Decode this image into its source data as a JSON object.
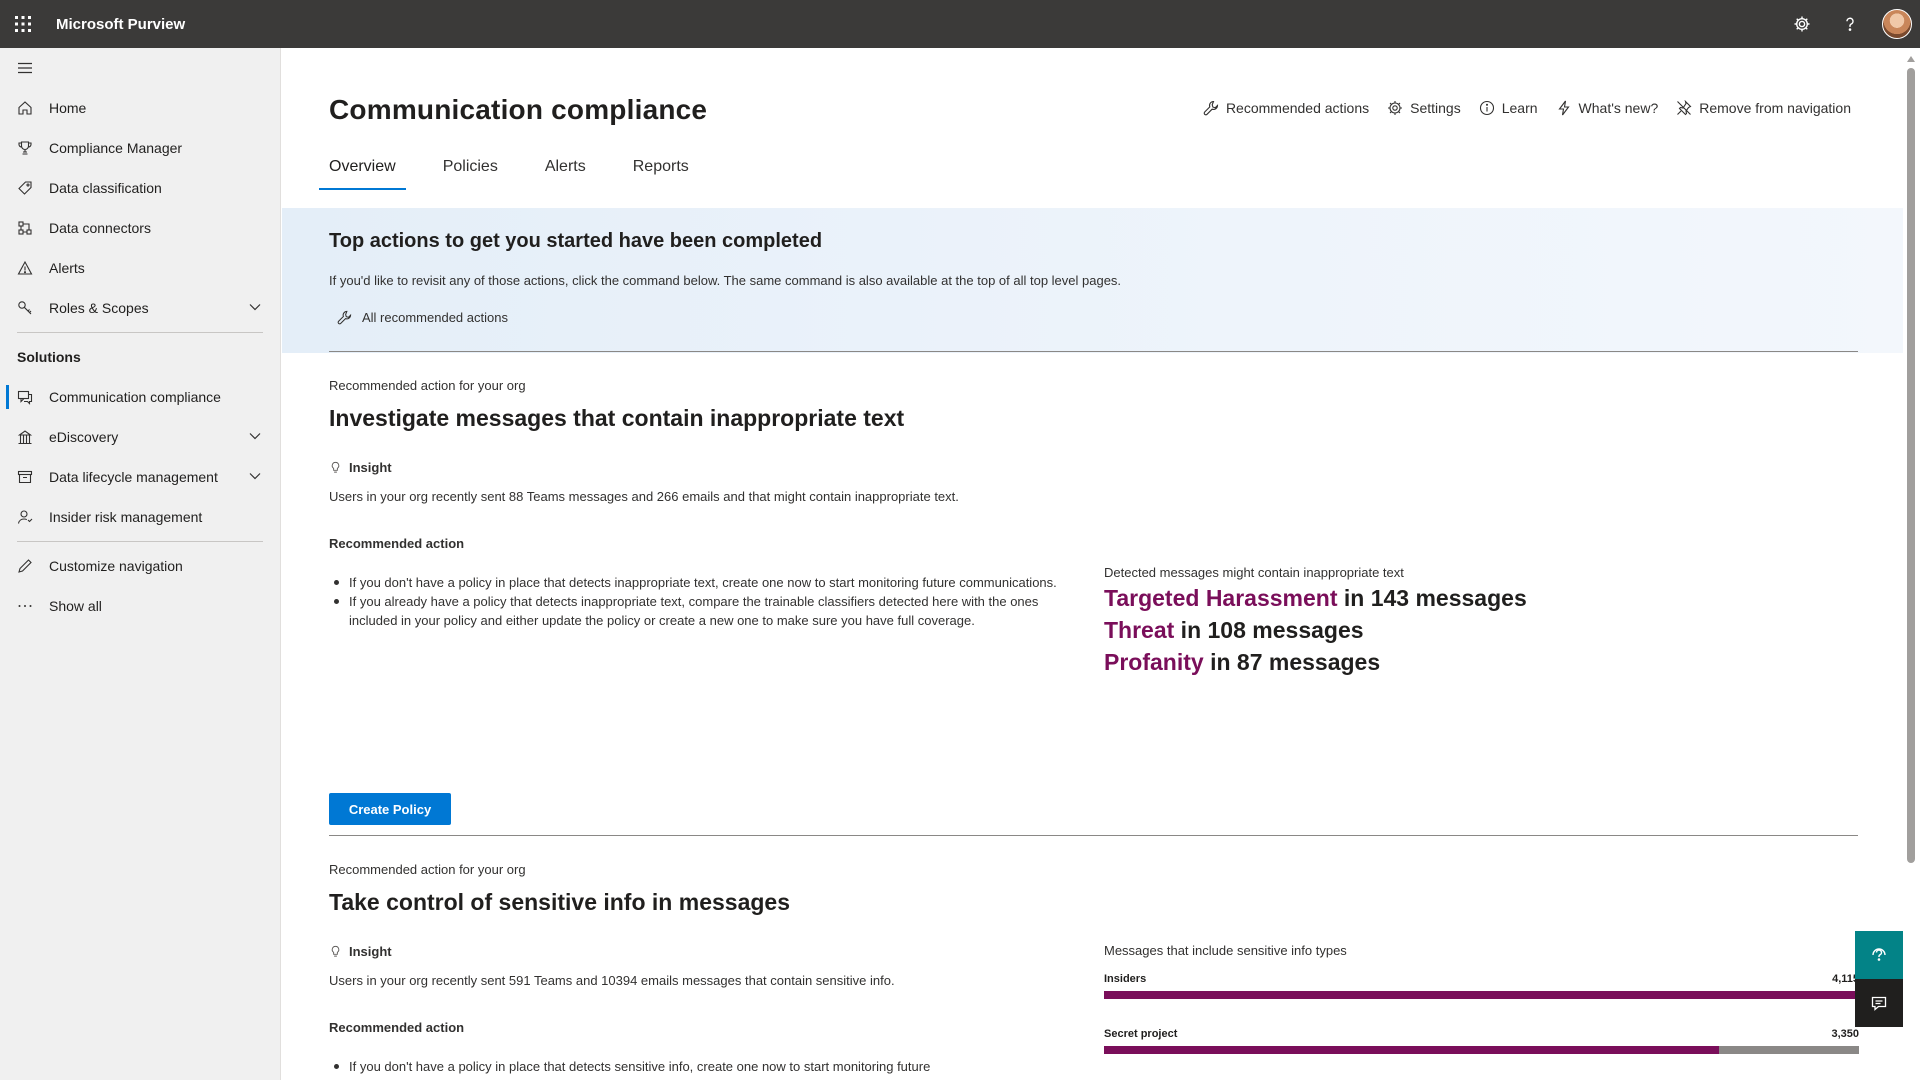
{
  "app": {
    "name": "Microsoft Purview"
  },
  "topbar": {
    "icons": [
      "waffle-icon",
      "settings-icon",
      "help-icon",
      "avatar"
    ]
  },
  "sidebar": {
    "items": [
      {
        "label": "Home",
        "icon": "home-icon"
      },
      {
        "label": "Compliance Manager",
        "icon": "trophy-icon"
      },
      {
        "label": "Data classification",
        "icon": "tag-icon"
      },
      {
        "label": "Data connectors",
        "icon": "connector-icon"
      },
      {
        "label": "Alerts",
        "icon": "warning-icon"
      },
      {
        "label": "Roles & Scopes",
        "icon": "key-icon",
        "expandable": true
      }
    ],
    "section_label": "Solutions",
    "solutions": [
      {
        "label": "Communication compliance",
        "icon": "chat-icon",
        "active": true
      },
      {
        "label": "eDiscovery",
        "icon": "building-icon",
        "expandable": true
      },
      {
        "label": "Data lifecycle management",
        "icon": "archive-icon",
        "expandable": true
      },
      {
        "label": "Insider risk management",
        "icon": "person-icon"
      }
    ],
    "footer": [
      {
        "label": "Customize navigation",
        "icon": "pencil-icon"
      },
      {
        "label": "Show all",
        "icon": "ellipsis-icon"
      }
    ]
  },
  "page": {
    "title": "Communication compliance",
    "commands": [
      {
        "label": "Recommended actions",
        "icon": "wrench-icon"
      },
      {
        "label": "Settings",
        "icon": "gear-icon"
      },
      {
        "label": "Learn",
        "icon": "info-icon"
      },
      {
        "label": "What's new?",
        "icon": "lightning-icon"
      },
      {
        "label": "Remove from navigation",
        "icon": "unpin-icon"
      }
    ],
    "tabs": [
      "Overview",
      "Policies",
      "Alerts",
      "Reports"
    ],
    "active_tab": "Overview"
  },
  "banner": {
    "title": "Top actions to get you started have been completed",
    "text": "If you'd like to revisit any of those actions, click the command below. The same command is also available at the top of all top level pages.",
    "link": "All recommended actions"
  },
  "card1": {
    "eyebrow": "Recommended action for your org",
    "title": "Investigate messages that contain inappropriate text",
    "insight_label": "Insight",
    "insight_text": "Users in your org recently sent 88 Teams messages and 266 emails and that might contain inappropriate text.",
    "rec_label": "Recommended action",
    "bullets": [
      "If you don't have a policy in place that detects inappropriate text, create one now to start monitoring future communications.",
      "If you already have a policy that detects inappropriate text, compare the trainable classifiers detected here with the ones included in your policy and either update the policy or create a new one to make sure you have full coverage."
    ],
    "detect_label": "Detected messages might contain inappropriate text",
    "detections": [
      {
        "term": "Targeted Harassment",
        "rest": " in 143 messages"
      },
      {
        "term": "Threat",
        "rest": " in 108 messages"
      },
      {
        "term": "Profanity",
        "rest": " in 87 messages"
      }
    ],
    "button": "Create Policy"
  },
  "card2": {
    "eyebrow": "Recommended action for your org",
    "title": "Take control of sensitive info in messages",
    "insight_label": "Insight",
    "insight_text": "Users in your org recently sent 591 Teams and 10394 emails messages that contain sensitive info.",
    "rec_label": "Recommended action",
    "bullet": "If you don't have a policy in place that detects sensitive info, create one now to start monitoring future",
    "chart_label": "Messages that include sensitive info types",
    "bars": [
      {
        "name": "Insiders",
        "value_label": "4,115",
        "value": 4115
      },
      {
        "name": "Secret project",
        "value_label": "3,350",
        "value": 3350
      }
    ]
  },
  "colors": {
    "accent": "#0078d4",
    "highlight": "#7a0e5a",
    "topbar": "#3b3a39"
  }
}
